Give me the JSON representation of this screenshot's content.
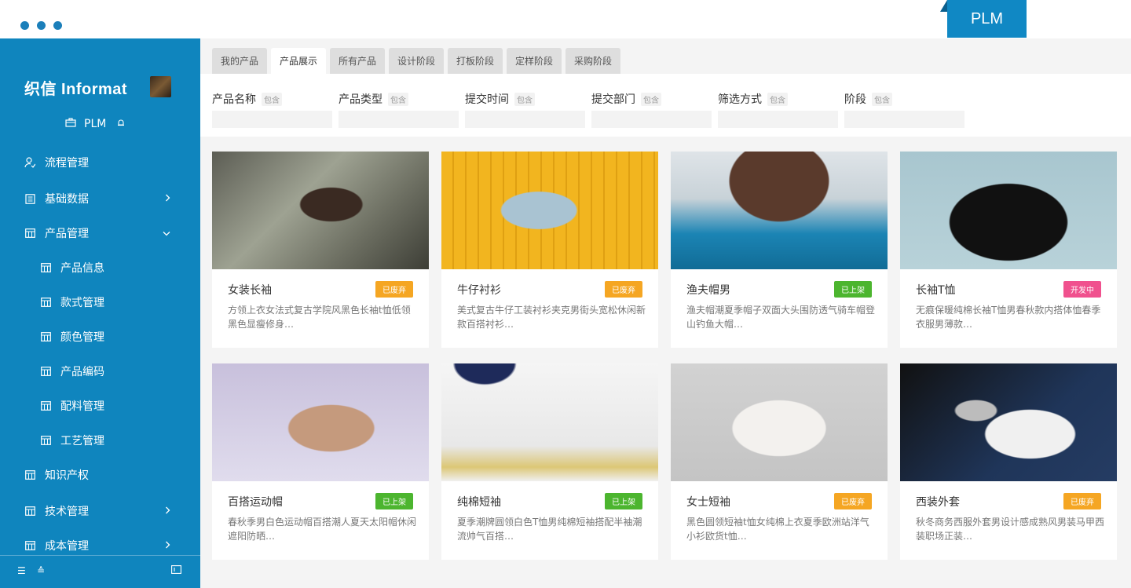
{
  "window": {
    "app_tab": "PLM"
  },
  "sidebar": {
    "logo": "织信 Informat",
    "app_name": "PLM",
    "items": [
      {
        "label": "流程管理",
        "icon": "user-flow-icon",
        "arrow": ""
      },
      {
        "label": "基础数据",
        "icon": "doc-icon",
        "arrow": "›"
      },
      {
        "label": "产品管理",
        "icon": "grid-icon",
        "arrow": "⌄"
      },
      {
        "label": "产品信息",
        "icon": "grid-icon",
        "arrow": ""
      },
      {
        "label": "款式管理",
        "icon": "grid-icon",
        "arrow": ""
      },
      {
        "label": "颜色管理",
        "icon": "grid-icon",
        "arrow": ""
      },
      {
        "label": "产品编码",
        "icon": "grid-icon",
        "arrow": ""
      },
      {
        "label": "配料管理",
        "icon": "grid-icon",
        "arrow": ""
      },
      {
        "label": "工艺管理",
        "icon": "grid-icon",
        "arrow": ""
      },
      {
        "label": "知识产权",
        "icon": "grid-icon",
        "arrow": ""
      },
      {
        "label": "技术管理",
        "icon": "grid-icon",
        "arrow": "›"
      },
      {
        "label": "成本管理",
        "icon": "grid-icon",
        "arrow": "›"
      }
    ]
  },
  "tabs": [
    "我的产品",
    "产品展示",
    "所有产品",
    "设计阶段",
    "打板阶段",
    "定样阶段",
    "采购阶段"
  ],
  "active_tab": "产品展示",
  "filters": [
    {
      "label": "产品名称",
      "tag": "包含"
    },
    {
      "label": "产品类型",
      "tag": "包含"
    },
    {
      "label": "提交时间",
      "tag": "包含"
    },
    {
      "label": "提交部门",
      "tag": "包含"
    },
    {
      "label": "筛选方式",
      "tag": "包含"
    },
    {
      "label": "阶段",
      "tag": "包含"
    }
  ],
  "status_colors": {
    "已废弃": "#f5a623",
    "已上架": "#4cb52f",
    "开发中": "#f0518e"
  },
  "products": [
    {
      "title": "女装长袖",
      "status": "已废弃",
      "desc": "方领上衣女法式复古学院风黑色长袖t恤低领黑色显瘦修身…"
    },
    {
      "title": "牛仔衬衫",
      "status": "已废弃",
      "desc": "美式复古牛仔工装衬衫夹克男街头宽松休闲新款百搭衬衫…"
    },
    {
      "title": "渔夫帽男",
      "status": "已上架",
      "desc": "渔夫帽潮夏季帽子双面大头围防透气骑车帽登山钓鱼大帽…"
    },
    {
      "title": "长袖T恤",
      "status": "开发中",
      "desc": "无痕保暖纯棉长袖T恤男春秋款内搭体恤春季衣服男薄款…"
    },
    {
      "title": "百搭运动帽",
      "status": "已上架",
      "desc": "春秋季男白色运动帽百搭潮人夏天太阳帽休闲遮阳防晒…"
    },
    {
      "title": "纯棉短袖",
      "status": "已上架",
      "desc": "夏季潮牌圆领白色T恤男纯棉短袖搭配半袖潮流帅气百搭…"
    },
    {
      "title": "女士短袖",
      "status": "已废弃",
      "desc": "黑色圆领短袖t恤女纯棉上衣夏季欧洲站洋气小衫欧货t恤…"
    },
    {
      "title": "西装外套",
      "status": "已废弃",
      "desc": "秋冬商务西服外套男设计感成熟风男装马甲西装职场正装…"
    }
  ]
}
